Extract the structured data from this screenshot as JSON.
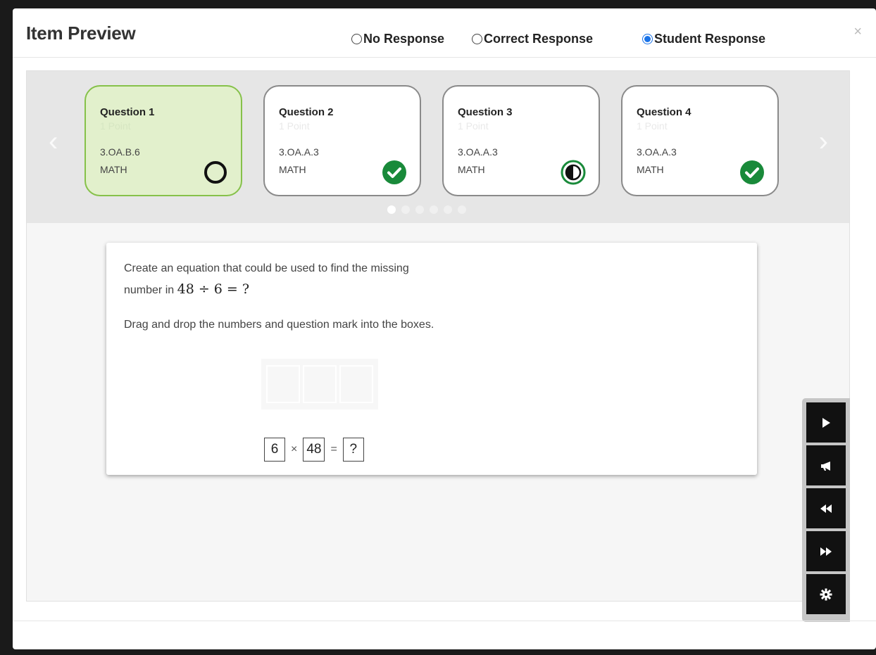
{
  "modal": {
    "title": "Item Preview",
    "close_icon": "×"
  },
  "response_options": [
    {
      "label": "No Response",
      "selected": false
    },
    {
      "label": "Correct Response",
      "selected": false
    },
    {
      "label": "Student Response",
      "selected": true
    }
  ],
  "carousel": {
    "prev_icon": "‹",
    "next_icon": "›",
    "pages": 6,
    "current_page": 1,
    "questions": [
      {
        "title": "Question 1",
        "subtitle": "1 Point",
        "standard": "3.OA.B.6",
        "subject": "MATH",
        "status": "unanswered",
        "status_icon": "empty-circle-icon",
        "active": true
      },
      {
        "title": "Question 2",
        "subtitle": "1 Point",
        "standard": "3.OA.A.3",
        "subject": "MATH",
        "status": "correct",
        "status_icon": "check-circle-icon",
        "active": false
      },
      {
        "title": "Question 3",
        "subtitle": "1 Point",
        "standard": "3.OA.A.3",
        "subject": "MATH",
        "status": "partial",
        "status_icon": "half-circle-icon",
        "active": false
      },
      {
        "title": "Question 4",
        "subtitle": "1 Point",
        "standard": "3.OA.A.3",
        "subject": "MATH",
        "status": "correct",
        "status_icon": "check-circle-icon",
        "active": false
      }
    ]
  },
  "question": {
    "prompt_line1": "Create an equation that could be used to find the missing",
    "prompt_line2_prefix": "number in",
    "prompt_math": "48 ÷ 6 = ?",
    "instruction": "Drag and drop the numbers and question mark into the boxes.",
    "tiles": {
      "first": "6",
      "times": "×",
      "second": "48",
      "equals": "=",
      "third": "?"
    }
  },
  "toolbar": {
    "buttons": [
      "play-icon",
      "megaphone-icon",
      "rewind-icon",
      "fast-forward-icon",
      "gear-icon"
    ]
  },
  "colors": {
    "active_card_bg": "#e2f0cc",
    "active_card_border": "#86c14a",
    "correct_green": "#198a3a",
    "radio_blue": "#1a73e8"
  }
}
